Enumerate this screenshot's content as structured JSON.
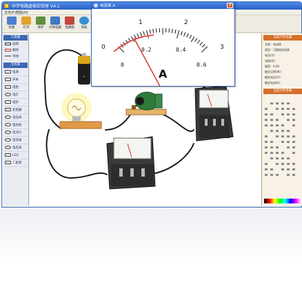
{
  "window": {
    "title": "中学电路虚拟实验室 V4.1"
  },
  "menu": {
    "items": [
      "文件(F)",
      "帮助(H)"
    ]
  },
  "toolbar": {
    "buttons": [
      {
        "label": "新建",
        "color": "#4e7fd1"
      },
      {
        "label": "打开",
        "color": "#e2a12b"
      },
      {
        "label": "保存",
        "color": "#5f8f3d"
      },
      {
        "label": "示例电路",
        "color": "#3d79c4"
      },
      {
        "label": "电路图",
        "color": "#c0473a"
      },
      {
        "label": "帮助",
        "color": "#3a8ed0"
      }
    ]
  },
  "left_panel": {
    "tools_header": "工具箱",
    "tools": [
      "选择",
      "删除",
      "导线"
    ],
    "parts_header": "元件库",
    "parts": [
      "电源",
      "开关",
      "电阻",
      "电灯",
      "电铃",
      "变阻器",
      "电压表",
      "电动机",
      "电流计",
      "电流表",
      "电压表",
      "LED",
      "二极管"
    ]
  },
  "meter_window": {
    "title": "电流表 A",
    "scale_top": [
      "0",
      "1",
      "2",
      "3"
    ],
    "scale_bottom": [
      "0",
      "0.2",
      "0.4",
      "0.6"
    ],
    "unit": "A",
    "needle_value": 0.11,
    "scale_max": 0.6
  },
  "right_panel": {
    "props_header": "当前元件设置",
    "props": [
      "名称：电流表",
      "类别：可量程电流表",
      "电压(V)：",
      "电阻(Ω)：",
      "量程：0.6A",
      "额定功率(W)：",
      "额定电压(V)：",
      "额定电流(A)："
    ],
    "parts_header": "当前元件参数"
  },
  "colors": {
    "accent_blue": "#3f67b3",
    "accent_orange": "#d4702a",
    "needle": "#d43a2a"
  }
}
